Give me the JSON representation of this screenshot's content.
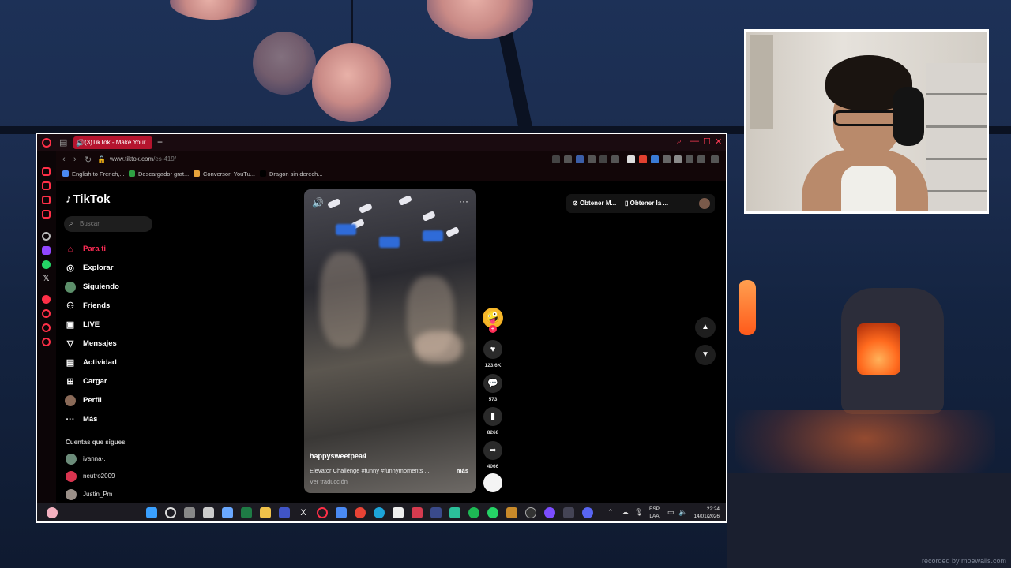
{
  "browser": {
    "tab_title": "(3)TikTok - Make Your",
    "new_tab": "+",
    "url_host": "www.tiktok.com",
    "url_path": "/es-419/",
    "bookmarks": [
      "English to French,...",
      "Descargador grat...",
      "Conversor: YouTu...",
      "Dragon sin derech..."
    ]
  },
  "tiktok": {
    "logo": "TikTok",
    "search_placeholder": "Buscar",
    "menu": [
      {
        "label": "Para ti",
        "icon": "home-icon",
        "active": true
      },
      {
        "label": "Explorar",
        "icon": "compass-icon",
        "active": false
      },
      {
        "label": "Siguiendo",
        "icon": "following-avatar-icon",
        "active": false
      },
      {
        "label": "Friends",
        "icon": "friends-icon",
        "active": false
      },
      {
        "label": "LIVE",
        "icon": "live-tv-icon",
        "active": false
      },
      {
        "label": "Mensajes",
        "icon": "paper-plane-icon",
        "active": false
      },
      {
        "label": "Actividad",
        "icon": "activity-icon",
        "active": false
      },
      {
        "label": "Cargar",
        "icon": "upload-plus-icon",
        "active": false
      },
      {
        "label": "Perfil",
        "icon": "profile-avatar-icon",
        "active": false
      },
      {
        "label": "Más",
        "icon": "more-dots-icon",
        "active": false
      }
    ],
    "following_header": "Cuentas que sigues",
    "following": [
      "ivanna-.",
      "neutro2009",
      "Justin_Pm"
    ],
    "top_buttons": {
      "get_coins": "Obtener M...",
      "get_app": "Obtener la ..."
    },
    "video": {
      "author": "happysweetpea4",
      "caption": "Elevator Challenge #funny #funnymoments ...",
      "more": "más",
      "translate": "Ver traducción",
      "likes": "123.6K",
      "comments": "573",
      "saves": "8268",
      "shares": "4066"
    }
  },
  "taskbar": {
    "lang_top": "ESP",
    "lang_bottom": "LAA",
    "time": "22:24",
    "date": "14/01/2026"
  },
  "watermark": "recorded by moewalls.com"
}
